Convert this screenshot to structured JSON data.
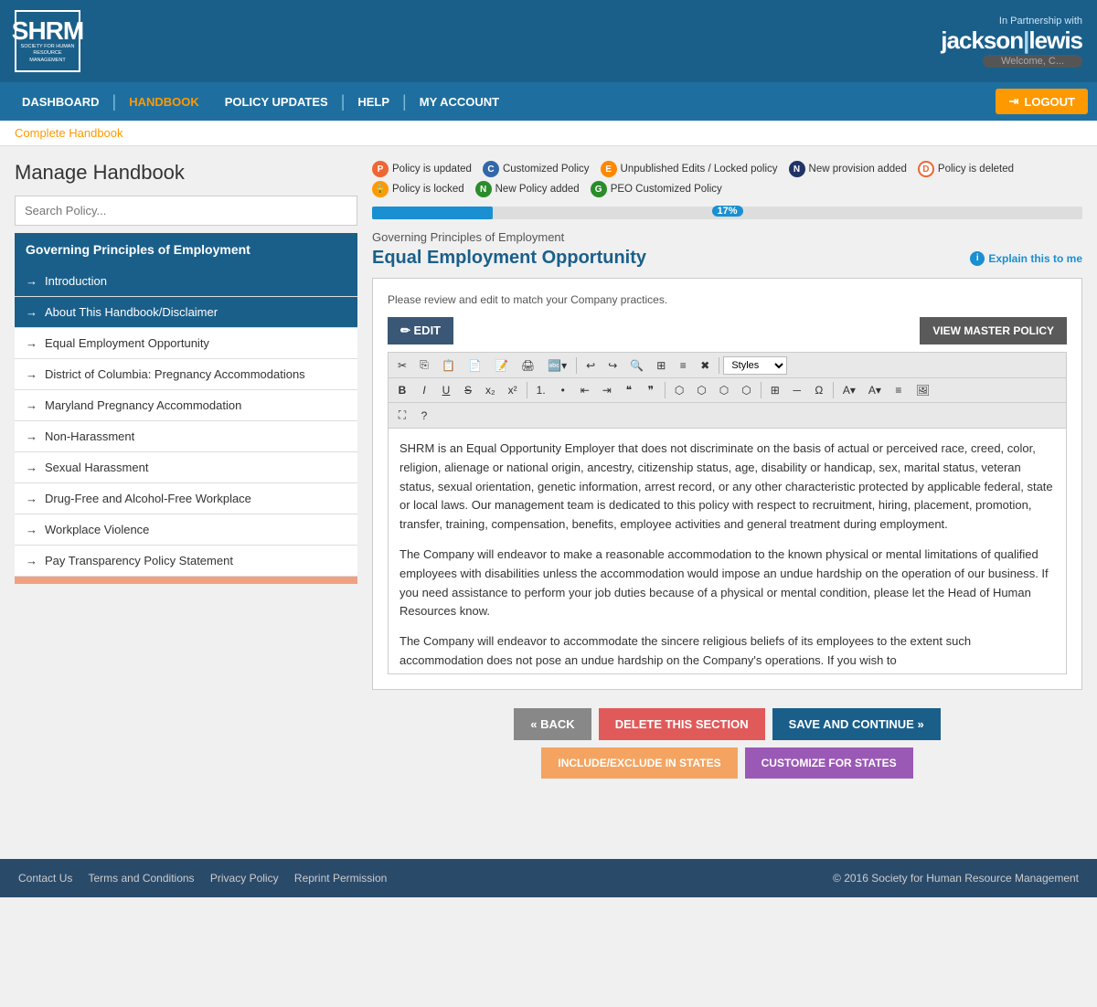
{
  "header": {
    "shrm_letters": "SHRM",
    "shrm_sub": "SOCIETY FOR HUMAN\nRESOURCE MANAGEMENT",
    "partner_label": "In Partnership with",
    "partner_name": "jackson|lewis",
    "welcome": "Welcome, C...",
    "logout_label": "LOGOUT"
  },
  "nav": {
    "items": [
      {
        "label": "DASHBOARD",
        "active": false
      },
      {
        "label": "HANDBOOK",
        "active": true
      },
      {
        "label": "POLICY UPDATES",
        "active": false
      },
      {
        "label": "HELP",
        "active": false
      },
      {
        "label": "MY ACCOUNT",
        "active": false
      }
    ]
  },
  "breadcrumb": "Complete Handbook",
  "sidebar": {
    "title": "Manage Handbook",
    "search_placeholder": "Search Policy...",
    "section_header": "Governing Principles of Employment",
    "items": [
      {
        "label": "Introduction",
        "active": false,
        "two_line": false
      },
      {
        "label": "About This Handbook/Disclaimer",
        "active": true,
        "two_line": false
      },
      {
        "label": "Equal Employment Opportunity",
        "active": false,
        "two_line": false
      },
      {
        "label": "District of Columbia: Pregnancy Accommodations",
        "active": false,
        "two_line": true
      },
      {
        "label": "Maryland Pregnancy Accommodation",
        "active": false,
        "two_line": false
      },
      {
        "label": "Non-Harassment",
        "active": false,
        "two_line": false
      },
      {
        "label": "Sexual Harassment",
        "active": false,
        "two_line": false
      },
      {
        "label": "Drug-Free and Alcohol-Free Workplace",
        "active": false,
        "two_line": false
      },
      {
        "label": "Workplace Violence",
        "active": false,
        "two_line": false
      },
      {
        "label": "Pay Transparency Policy Statement",
        "active": false,
        "two_line": false
      }
    ]
  },
  "legend": {
    "items": [
      {
        "badge": "P",
        "badge_class": "badge-p",
        "label": "Policy is updated"
      },
      {
        "badge": "C",
        "badge_class": "badge-c",
        "label": "Customized Policy"
      },
      {
        "badge": "E",
        "badge_class": "badge-e",
        "label": "Unpublished Edits / Locked policy"
      },
      {
        "badge": "N",
        "badge_class": "badge-n",
        "label": "New provision added"
      },
      {
        "badge": "D",
        "badge_class": "badge-d",
        "label": "Policy is deleted"
      },
      {
        "badge": "🔒",
        "badge_class": "badge-lock",
        "label": "Policy is locked"
      },
      {
        "badge": "N",
        "badge_class": "badge-n2",
        "label": "New Policy added"
      },
      {
        "badge": "G",
        "badge_class": "badge-peo",
        "label": "PEO Customized Policy"
      }
    ]
  },
  "progress": {
    "value": 17,
    "label": "17%"
  },
  "policy": {
    "section": "Governing Principles of Employment",
    "title": "Equal Employment Opportunity",
    "explain_label": "Explain this to me",
    "hint": "Please review and edit to match your Company practices.",
    "edit_btn": "✏ EDIT",
    "view_master_btn": "VIEW MASTER POLICY",
    "content_paragraphs": [
      "SHRM is an Equal Opportunity Employer that does not discriminate on the basis of actual or perceived race, creed, color, religion, alienage or national origin, ancestry, citizenship status, age, disability or handicap, sex, marital status, veteran status, sexual orientation, genetic information, arrest record, or any other characteristic protected by applicable federal, state or local laws. Our management team is dedicated to this policy with respect to recruitment, hiring, placement, promotion, transfer, training, compensation, benefits, employee activities and general treatment during employment.",
      "The Company will endeavor to make a reasonable accommodation to the known physical or mental limitations of qualified employees with disabilities unless the accommodation would impose an undue hardship on the operation of our business. If you need assistance to perform your job duties because of a physical or mental condition, please let the Head of Human Resources know.",
      "The Company will endeavor to accommodate the sincere religious beliefs of its employees to the extent such accommodation does not pose an undue hardship on the Company's operations. If you wish to"
    ]
  },
  "buttons": {
    "back": "« BACK",
    "delete": "DELETE THIS SECTION",
    "save": "SAVE AND CONTINUE »",
    "include": "INCLUDE/EXCLUDE IN STATES",
    "customize": "CUSTOMIZE FOR STATES"
  },
  "footer": {
    "links": [
      "Contact Us",
      "Terms and Conditions",
      "Privacy Policy",
      "Reprint Permission"
    ],
    "copyright": "© 2016 Society for Human Resource Management"
  }
}
